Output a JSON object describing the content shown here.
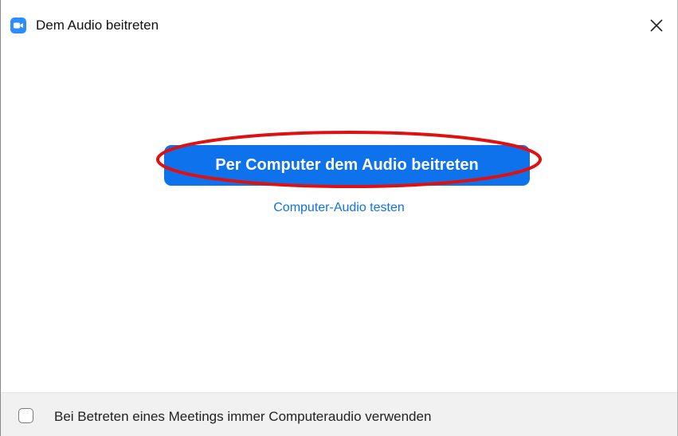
{
  "window": {
    "title": "Dem Audio beitreten",
    "app_icon": "zoom-camera-icon",
    "close_icon": "close-icon"
  },
  "main": {
    "join_button_label": "Per Computer dem Audio beitreten",
    "test_link_label": "Computer-Audio testen",
    "highlight": "red-ellipse-annotation"
  },
  "footer": {
    "checkbox_label": "Bei Betreten eines Meetings immer Computeraudio verwenden",
    "checkbox_checked": false
  },
  "colors": {
    "accent": "#0e72ed",
    "app_icon": "#2d8cff",
    "annotation": "#e01010",
    "footer_bg": "#f1f1f1"
  }
}
